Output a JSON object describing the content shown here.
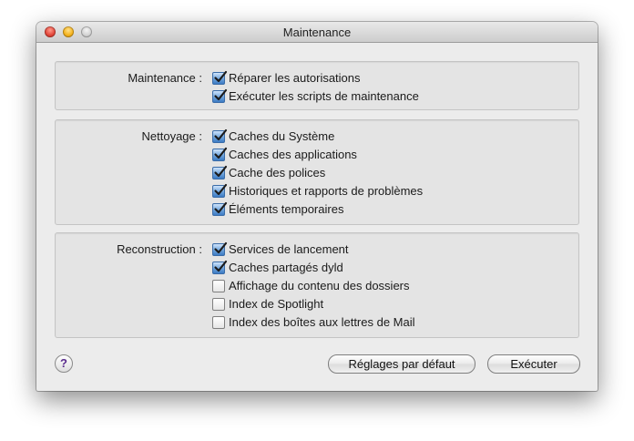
{
  "window": {
    "title": "Maintenance"
  },
  "groups": [
    {
      "label": "Maintenance :",
      "items": [
        {
          "label": "Réparer les autorisations",
          "checked": true
        },
        {
          "label": "Exécuter les scripts de maintenance",
          "checked": true
        }
      ]
    },
    {
      "label": "Nettoyage :",
      "items": [
        {
          "label": "Caches du Système",
          "checked": true
        },
        {
          "label": "Caches des applications",
          "checked": true
        },
        {
          "label": "Cache des polices",
          "checked": true
        },
        {
          "label": "Historiques et rapports de problèmes",
          "checked": true
        },
        {
          "label": "Éléments temporaires",
          "checked": true
        }
      ]
    },
    {
      "label": "Reconstruction :",
      "items": [
        {
          "label": "Services de lancement",
          "checked": true
        },
        {
          "label": "Caches partagés dyld",
          "checked": true
        },
        {
          "label": "Affichage du contenu des dossiers",
          "checked": false
        },
        {
          "label": "Index de Spotlight",
          "checked": false
        },
        {
          "label": "Index des boîtes aux lettres de Mail",
          "checked": false
        }
      ]
    }
  ],
  "footer": {
    "help_label": "?",
    "reset_label": "Réglages par défaut",
    "run_label": "Exécuter"
  }
}
